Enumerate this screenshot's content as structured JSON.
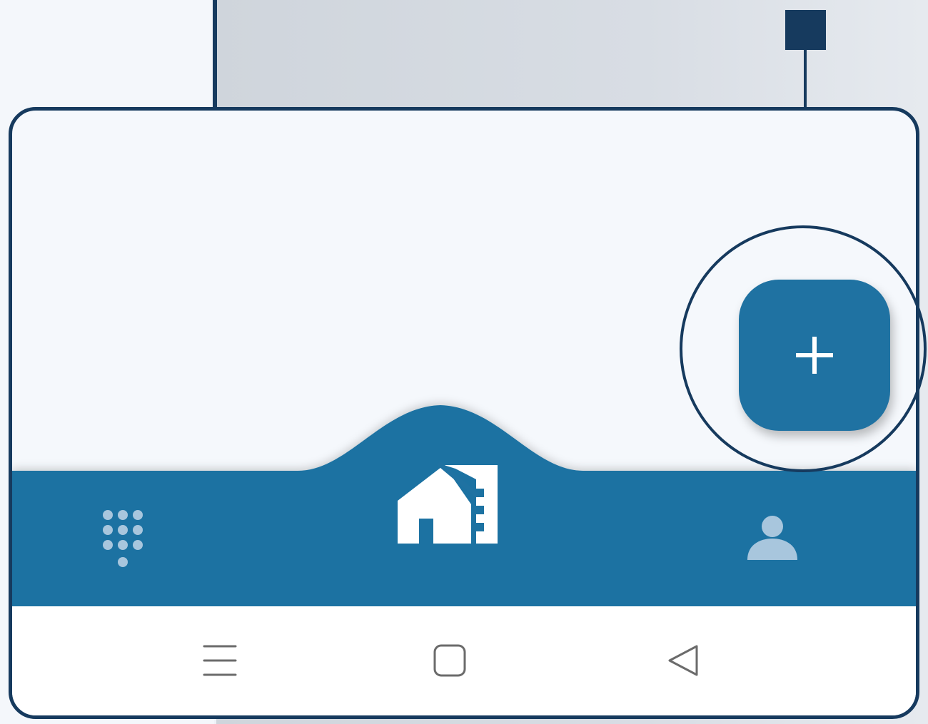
{
  "colors": {
    "nav_bar": "#1f72a2",
    "annotation": "#163a5e",
    "nav_icon_muted": "#a8c6dd",
    "nav_icon_active": "#ffffff",
    "system_bar": "#ffffff",
    "content_bg": "#f5f8fc"
  },
  "fab": {
    "icon": "plus-icon"
  },
  "bottom_nav": {
    "items": [
      {
        "icon": "dialpad-icon",
        "active": false
      },
      {
        "icon": "home-building-icon",
        "active": true
      },
      {
        "icon": "person-icon",
        "active": false
      }
    ]
  },
  "system_nav": {
    "buttons": [
      {
        "icon": "recent-apps-icon"
      },
      {
        "icon": "home-square-icon"
      },
      {
        "icon": "back-triangle-icon"
      }
    ]
  },
  "annotation": {
    "shape": "circle",
    "target": "fab"
  }
}
